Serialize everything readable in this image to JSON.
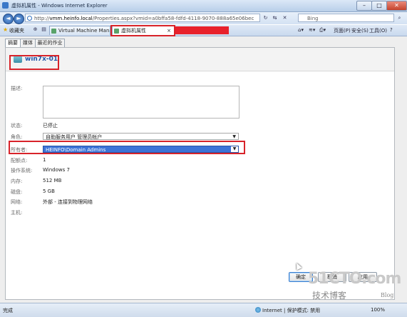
{
  "window": {
    "title": "虚拟机属性 - Windows Internet Explorer",
    "min_icon": "minimize-icon",
    "max_icon": "maximize-icon",
    "close_icon": "close-icon"
  },
  "address": {
    "prefix": "http://",
    "domain": "vmm.heinfo.local",
    "rest": "/Properties.aspx?vmid=a0bffa58-fdfd-4118-9070-888a65e06bec",
    "search_placeholder": "Bing"
  },
  "favorites": {
    "label": "收藏夹"
  },
  "tabs": [
    {
      "label": "Virtual Machine Mana..."
    },
    {
      "label": "虚拟机属性",
      "close": "×"
    }
  ],
  "commandbar": {
    "page": "页面(P)",
    "safety": "安全(S)",
    "tools": "工具(O)",
    "help": "?"
  },
  "page_tabs": [
    "摘要",
    "媒体",
    "最近的作业"
  ],
  "vm": {
    "name": "win7x-01"
  },
  "fields": {
    "description_label": "描述:",
    "status_label": "状态:",
    "status_value": "已停止",
    "role_label": "角色:",
    "role_value": "自助服务用户 管理员帐户",
    "owner_label": "所有者:",
    "owner_value": "HEINFO\\Domain Admins",
    "config_label": "配额点:",
    "config_value": "1",
    "os_label": "操作系统:",
    "os_value": "Windows 7",
    "memory_label": "内存:",
    "memory_value": "512 MB",
    "disk_label": "磁盘:",
    "disk_value": "5 GB",
    "network_label": "网络:",
    "network_value": "外部 - 连接到物理网络",
    "host_label": "主机:"
  },
  "buttons": {
    "ok": "确定",
    "cancel": "取消",
    "apply": "应用"
  },
  "status": {
    "done": "完成",
    "zone": "Internet | 保护模式: 禁用",
    "zoom": "100%"
  },
  "watermark": {
    "line1": "51CTO.com",
    "line2": "技术博客",
    "line3": "Blog"
  },
  "colors": {
    "highlight": "#d8232a",
    "link": "#1f55a7",
    "selection": "#3c74d8"
  }
}
